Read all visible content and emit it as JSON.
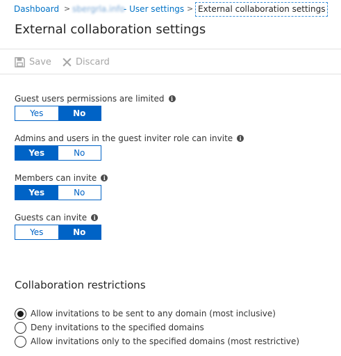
{
  "breadcrumb": {
    "dashboard": "Dashboard",
    "tenant": "sbergrla.info",
    "user_settings": "- User settings",
    "current": "External collaboration settings",
    "separator": ">"
  },
  "page": {
    "title": "External collaboration settings"
  },
  "toolbar": {
    "save_label": "Save",
    "discard_label": "Discard"
  },
  "settings": [
    {
      "label": "Guest users permissions are limited",
      "yes": "Yes",
      "no": "No",
      "selected": "no"
    },
    {
      "label": "Admins and users in the guest inviter role can invite",
      "yes": "Yes",
      "no": "No",
      "selected": "yes"
    },
    {
      "label": "Members can invite",
      "yes": "Yes",
      "no": "No",
      "selected": "yes"
    },
    {
      "label": "Guests can invite",
      "yes": "Yes",
      "no": "No",
      "selected": "no"
    }
  ],
  "restrictions": {
    "heading": "Collaboration restrictions",
    "options": [
      {
        "label": "Allow invitations to be sent to any domain (most inclusive)",
        "selected": true
      },
      {
        "label": "Deny invitations to the specified domains",
        "selected": false
      },
      {
        "label": "Allow invitations only to the specified domains (most restrictive)",
        "selected": false
      }
    ]
  },
  "colors": {
    "accent": "#0063c6",
    "link": "#0072c6",
    "disabled": "#a6a6a6"
  },
  "icons": {
    "info": "i"
  }
}
